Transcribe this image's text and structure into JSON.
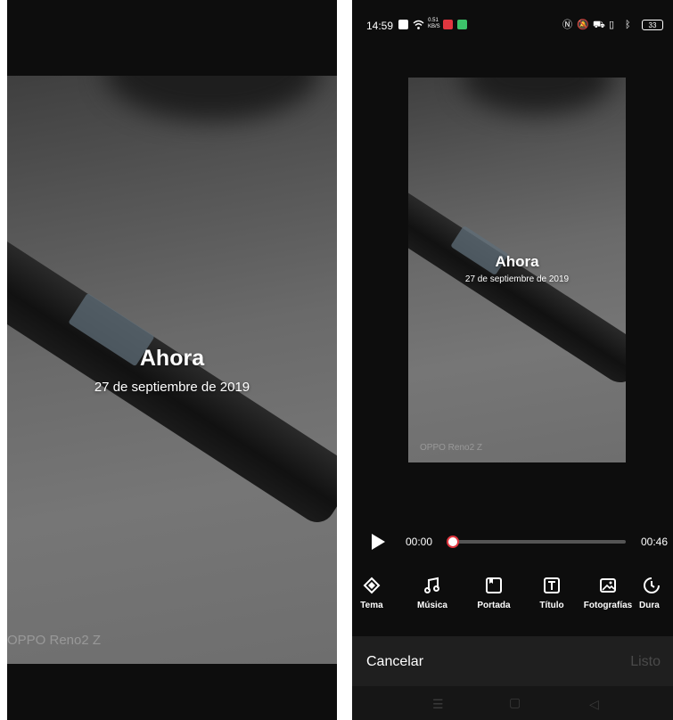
{
  "left_preview": {
    "title": "Ahora",
    "date": "27 de septiembre de 2019",
    "watermark": "OPPO Reno2 Z"
  },
  "status_bar": {
    "time": "14:59",
    "net_speed": "0.51\nKB/S",
    "battery": "33"
  },
  "preview": {
    "title": "Ahora",
    "date": "27 de septiembre de 2019",
    "watermark": "OPPO Reno2 Z"
  },
  "playback": {
    "current_time": "00:00",
    "total_time": "00:46",
    "progress": 0.0
  },
  "tools": [
    {
      "label": "Tema",
      "icon": "theme-icon"
    },
    {
      "label": "Música",
      "icon": "music-icon"
    },
    {
      "label": "Portada",
      "icon": "cover-icon"
    },
    {
      "label": "Título",
      "icon": "title-icon"
    },
    {
      "label": "Fotografías",
      "icon": "photos-icon"
    },
    {
      "label": "Dura",
      "icon": "duration-icon"
    }
  ],
  "actions": {
    "cancel": "Cancelar",
    "done": "Listo"
  },
  "colors": {
    "accent": "#e0363f",
    "background": "#0d0d0d"
  }
}
